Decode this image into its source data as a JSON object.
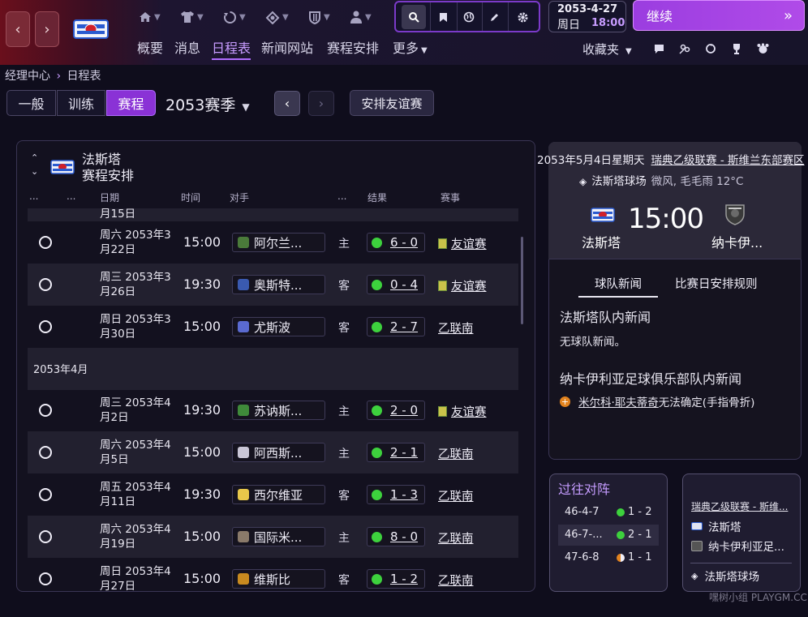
{
  "topbar": {
    "back_icon": "chevron-left-icon",
    "forward_icon": "chevron-right-icon",
    "nav_icons": [
      "home-icon",
      "shirt-icon",
      "refresh-icon",
      "tactics-icon",
      "shield-icon",
      "staff-icon"
    ],
    "tools": [
      "search-icon",
      "bookmark-icon",
      "globe-icon",
      "edit-icon",
      "settings-icon"
    ],
    "date": "2053-4-27",
    "weekday": "周日",
    "clock": "18:00",
    "continue_label": "继续",
    "favorites_label": "收藏夹",
    "right_icons": [
      "chat-icon",
      "people-icon",
      "sync-icon",
      "trophy-icon",
      "fans-icon"
    ],
    "accent": "#b04be8"
  },
  "nav": {
    "items": [
      "概要",
      "消息",
      "日程表",
      "新闻网站",
      "赛程安排",
      "更多"
    ],
    "active": "日程表"
  },
  "breadcrumb": {
    "parent": "经理中心",
    "current": "日程表"
  },
  "toolbar": {
    "tabs": [
      "一般",
      "训练",
      "赛程"
    ],
    "active_tab": "赛程",
    "season": "2053赛季",
    "friendly_label": "安排友谊赛"
  },
  "schedule": {
    "team_name": "法斯塔",
    "subtitle": "赛程安排",
    "columns": [
      "...",
      "...",
      "日期",
      "时间",
      "对手",
      "...",
      "结果",
      "赛事"
    ],
    "partial_row_text": "月15日",
    "month_label": "2053年4月",
    "rows": [
      {
        "date": "周六 2053年3月22日",
        "time": "15:00",
        "opponent": "阿尔兰...",
        "venue": "主",
        "score": "6 - 0",
        "competition": "友谊赛",
        "badge_color": "#4a7a3a"
      },
      {
        "date": "周三 2053年3月26日",
        "time": "19:30",
        "opponent": "奥斯特...",
        "venue": "客",
        "score": "0 - 4",
        "competition": "友谊赛",
        "badge_color": "#3a5ab0"
      },
      {
        "date": "周日 2053年3月30日",
        "time": "15:00",
        "opponent": "尤斯波",
        "venue": "客",
        "score": "2 - 7",
        "competition": "乙联南",
        "badge_color": "#5a6ad0"
      },
      {
        "date": "周三 2053年4月2日",
        "time": "19:30",
        "opponent": "苏讷斯...",
        "venue": "主",
        "score": "2 - 0",
        "competition": "友谊赛",
        "badge_color": "#3f8a3a"
      },
      {
        "date": "周六 2053年4月5日",
        "time": "15:00",
        "opponent": "阿西斯...",
        "venue": "主",
        "score": "2 - 1",
        "competition": "乙联南",
        "badge_color": "#c9c6d6"
      },
      {
        "date": "周五 2053年4月11日",
        "time": "19:30",
        "opponent": "西尔维亚",
        "venue": "客",
        "score": "1 - 3",
        "competition": "乙联南",
        "badge_color": "#e8c84a"
      },
      {
        "date": "周六 2053年4月19日",
        "time": "15:00",
        "opponent": "国际米...",
        "venue": "主",
        "score": "8 - 0",
        "competition": "乙联南",
        "badge_color": "#8a7a6a"
      },
      {
        "date": "周日 2053年4月27日",
        "time": "15:00",
        "opponent": "维斯比",
        "venue": "客",
        "score": "1 - 2",
        "competition": "乙联南",
        "badge_color": "#c88a1f"
      }
    ]
  },
  "match": {
    "date": "2053年5月4日星期天",
    "competition": "瑞典乙级联赛 - 斯维兰东部赛区",
    "stadium": "法斯塔球场",
    "weather": "微风, 毛毛雨 12°C",
    "time": "15:00",
    "home": "法斯塔",
    "away": "纳卡伊...",
    "tabs": [
      "球队新闻",
      "比赛日安排规则"
    ],
    "active_tab": "球队新闻",
    "news": [
      {
        "title": "法斯塔队内新闻",
        "text": "无球队新闻。"
      },
      {
        "title": "纳卡伊利亚足球俱乐部队内新闻",
        "player": "米尔科·耶夫蒂奇",
        "text": "无法确定(手指骨折)"
      }
    ]
  },
  "history": {
    "title": "过往对阵",
    "rows": [
      {
        "date": "46-4-7",
        "score": "1 - 2",
        "result": "win"
      },
      {
        "date": "46-7-...",
        "score": "2 - 1",
        "result": "win"
      },
      {
        "date": "47-6-8",
        "score": "1 - 1",
        "result": "draw"
      }
    ]
  },
  "venue_card": {
    "competition": "瑞典乙级联赛 - 斯维...",
    "home": "法斯塔",
    "away": "纳卡伊利亚足...",
    "stadium": "法斯塔球场"
  },
  "watermark": "嘿树小组 PLAYGM.CC"
}
